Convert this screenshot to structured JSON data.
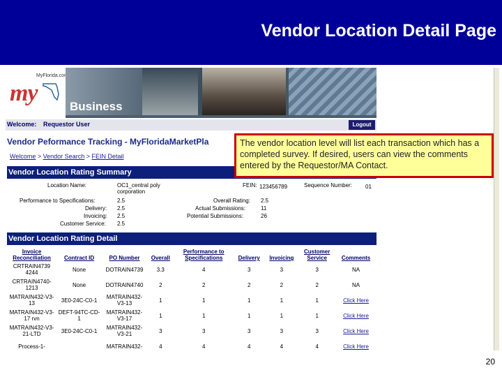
{
  "slide": {
    "title": "Vendor Location Detail Page",
    "page_number": "20"
  },
  "app": {
    "logo_site": "MyFlorida.com",
    "logo_text": "my",
    "banner_word": "Business",
    "welcome_label": "Welcome:",
    "welcome_user": "Requestor User",
    "logout_label": "Logout",
    "page_heading": "Vendor Peformance Tracking - MyFloridaMarketPla",
    "breadcrumb": [
      "Welcome",
      "Vendor Search",
      "FEIN Detail"
    ],
    "breadcrumb_sep": ">"
  },
  "summary": {
    "section_title": "Vendor Location Rating Summary",
    "location_name_label": "Location Name:",
    "location_name_value": "OC1_central poly corporation",
    "fein_label": "FEIN:",
    "fein_value": "123456789",
    "sequence_label": "Sequence Number:",
    "sequence_value": "01",
    "perf_label": "Performance to Specifications:",
    "perf_value": "2.5",
    "delivery_label": "Delivery:",
    "delivery_value": "2.5",
    "invoicing_label": "Invoicing:",
    "invoicing_value": "2.5",
    "customer_label": "Customer Service:",
    "customer_value": "2.5",
    "overall_label": "Overall Rating:",
    "overall_value": "2.5",
    "actual_label": "Actual Submissions:",
    "actual_value": "11",
    "potential_label": "Potential Submissions:",
    "potential_value": "26"
  },
  "detail": {
    "section_title": "Vendor Location Rating Detail",
    "headers": [
      "Invoice Reconciliation",
      "Contract ID",
      "PO Number",
      "Overall",
      "Performance to Specifications",
      "Delivery",
      "Invoicing",
      "Customer Service",
      "Comments"
    ],
    "rows": [
      [
        "CRTRAIN4739 4244",
        "None",
        "DOTRAIN4739",
        "3.3",
        "4",
        "3",
        "3",
        "3",
        "NA"
      ],
      [
        "CRTRAIN4740-1213",
        "None",
        "DOTRAIN4740",
        "2",
        "2",
        "2",
        "2",
        "2",
        "NA"
      ],
      [
        "MATRAIN432-V3-13",
        "3E0-24C-C0-1",
        "MATRAIN432-V3-13",
        "1",
        "1",
        "1",
        "1",
        "1",
        "Click Here"
      ],
      [
        "MATRAIN432-V3-17 rvn",
        "DEFT-94TC-CD-1",
        "MATRAIN432-V3-17",
        "1",
        "1",
        "1",
        "1",
        "1",
        "Click Here"
      ],
      [
        "MATRAIN432-V3-21-LTD",
        "3E0-24C-C0-1",
        "MATRAIN432-V3-21",
        "3",
        "3",
        "3",
        "3",
        "3",
        "Click Here"
      ],
      [
        "Process-1-",
        "",
        "MATRAIN432-",
        "4",
        "4",
        "4",
        "4",
        "4",
        "Click Here"
      ]
    ]
  },
  "callout": {
    "text": "The vendor location level will list each transaction which has a completed survey.  If desired, users can view the comments entered by the Requestor/MA Contact."
  }
}
